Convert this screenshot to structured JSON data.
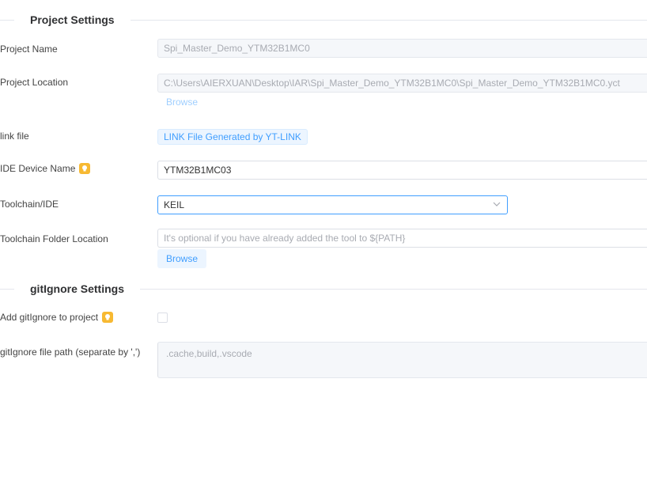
{
  "project_section": {
    "title": "Project Settings",
    "project_name": {
      "label": "Project Name",
      "value": "Spi_Master_Demo_YTM32B1MC0"
    },
    "project_location": {
      "label": "Project Location",
      "value": "C:\\Users\\AIERXUAN\\Desktop\\IAR\\Spi_Master_Demo_YTM32B1MC0\\Spi_Master_Demo_YTM32B1MC0.yct",
      "browse_label": "Browse"
    },
    "link_file": {
      "label": "link file",
      "tag": "LINK File Generated by YT-LINK"
    },
    "ide_device_name": {
      "label": "IDE Device Name",
      "value": "YTM32B1MC03",
      "hint_icon": "lightbulb-icon"
    },
    "toolchain": {
      "label": "Toolchain/IDE",
      "value": "KEIL",
      "dropdown_icon": "chevron-down-icon"
    },
    "toolchain_folder": {
      "label": "Toolchain Folder Location",
      "placeholder": "It's optional if you have already added the tool to ${PATH}",
      "browse_label": "Browse"
    }
  },
  "gitignore_section": {
    "title": "gitIgnore Settings",
    "add_gitignore": {
      "label": "Add gitIgnore to project",
      "hint_icon": "lightbulb-icon",
      "checked": false
    },
    "gitignore_path": {
      "label": "gitIgnore file path (separate by ',')",
      "value": ".cache,build,.vscode"
    }
  },
  "colors": {
    "accent": "#409eff",
    "hint_icon": "#f7b932"
  }
}
